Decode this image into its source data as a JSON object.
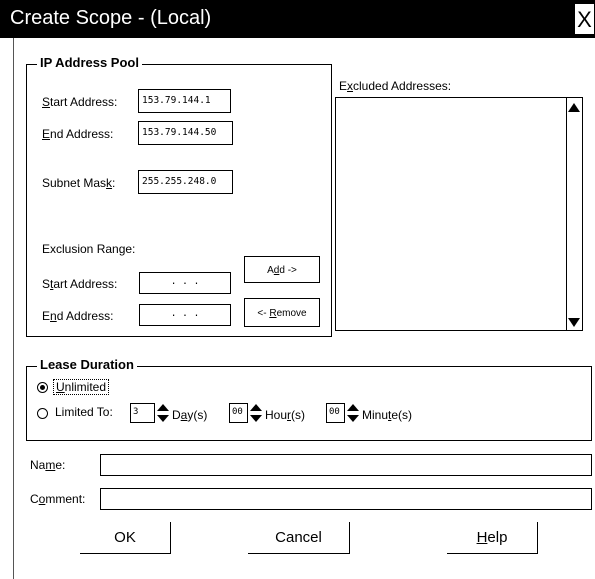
{
  "window": {
    "title": "Create Scope - (Local)",
    "close_glyph": "X"
  },
  "ip_pool": {
    "legend": "IP Address Pool",
    "start_label_u": "S",
    "start_label_rest": "tart Address:",
    "start_value": "153.79.144.1",
    "end_label_u": "E",
    "end_label_rest": "nd Address:",
    "end_value": "153.79.144.50",
    "mask_label_pre": "Subnet Mas",
    "mask_label_u": "k",
    "mask_label_rest": ":",
    "mask_value": "255.255.248.0",
    "excl_range_label": "Exclusion Range:",
    "excl_start_pre": "S",
    "excl_start_u": "t",
    "excl_start_rest": "art Address:",
    "excl_start_value": ". . .",
    "excl_end_pre": "E",
    "excl_end_u": "n",
    "excl_end_rest": "d Address:",
    "excl_end_value": ". . .",
    "add_pre": "A",
    "add_u": "d",
    "add_rest": "d ->",
    "remove_pre": "<- ",
    "remove_u": "R",
    "remove_rest": "emove",
    "excluded_pre": "E",
    "excluded_u": "x",
    "excluded_rest": "cluded Addresses:"
  },
  "lease": {
    "legend": "Lease Duration",
    "unlimited_u": "U",
    "unlimited_rest": "nlimited",
    "limited_label": "Limited To:",
    "days_value": "3",
    "days_pre": "D",
    "days_u": "a",
    "days_rest": "y(s)",
    "hours_value": "00",
    "hours_pre": "Hou",
    "hours_u": "r",
    "hours_rest": "(s)",
    "minutes_value": "00",
    "minutes_pre": "Minu",
    "minutes_u": "t",
    "minutes_rest": "e(s)"
  },
  "fields": {
    "name_pre": "Na",
    "name_u": "m",
    "name_rest": "e:",
    "name_value": "",
    "comment_pre": "C",
    "comment_u": "o",
    "comment_rest": "mment:",
    "comment_value": ""
  },
  "buttons": {
    "ok": "OK",
    "cancel": "Cancel",
    "help_u": "H",
    "help_rest": "elp"
  },
  "icons": {
    "scroll_up": "triangle-up",
    "scroll_down": "triangle-down",
    "spin": "updown-arrows"
  }
}
